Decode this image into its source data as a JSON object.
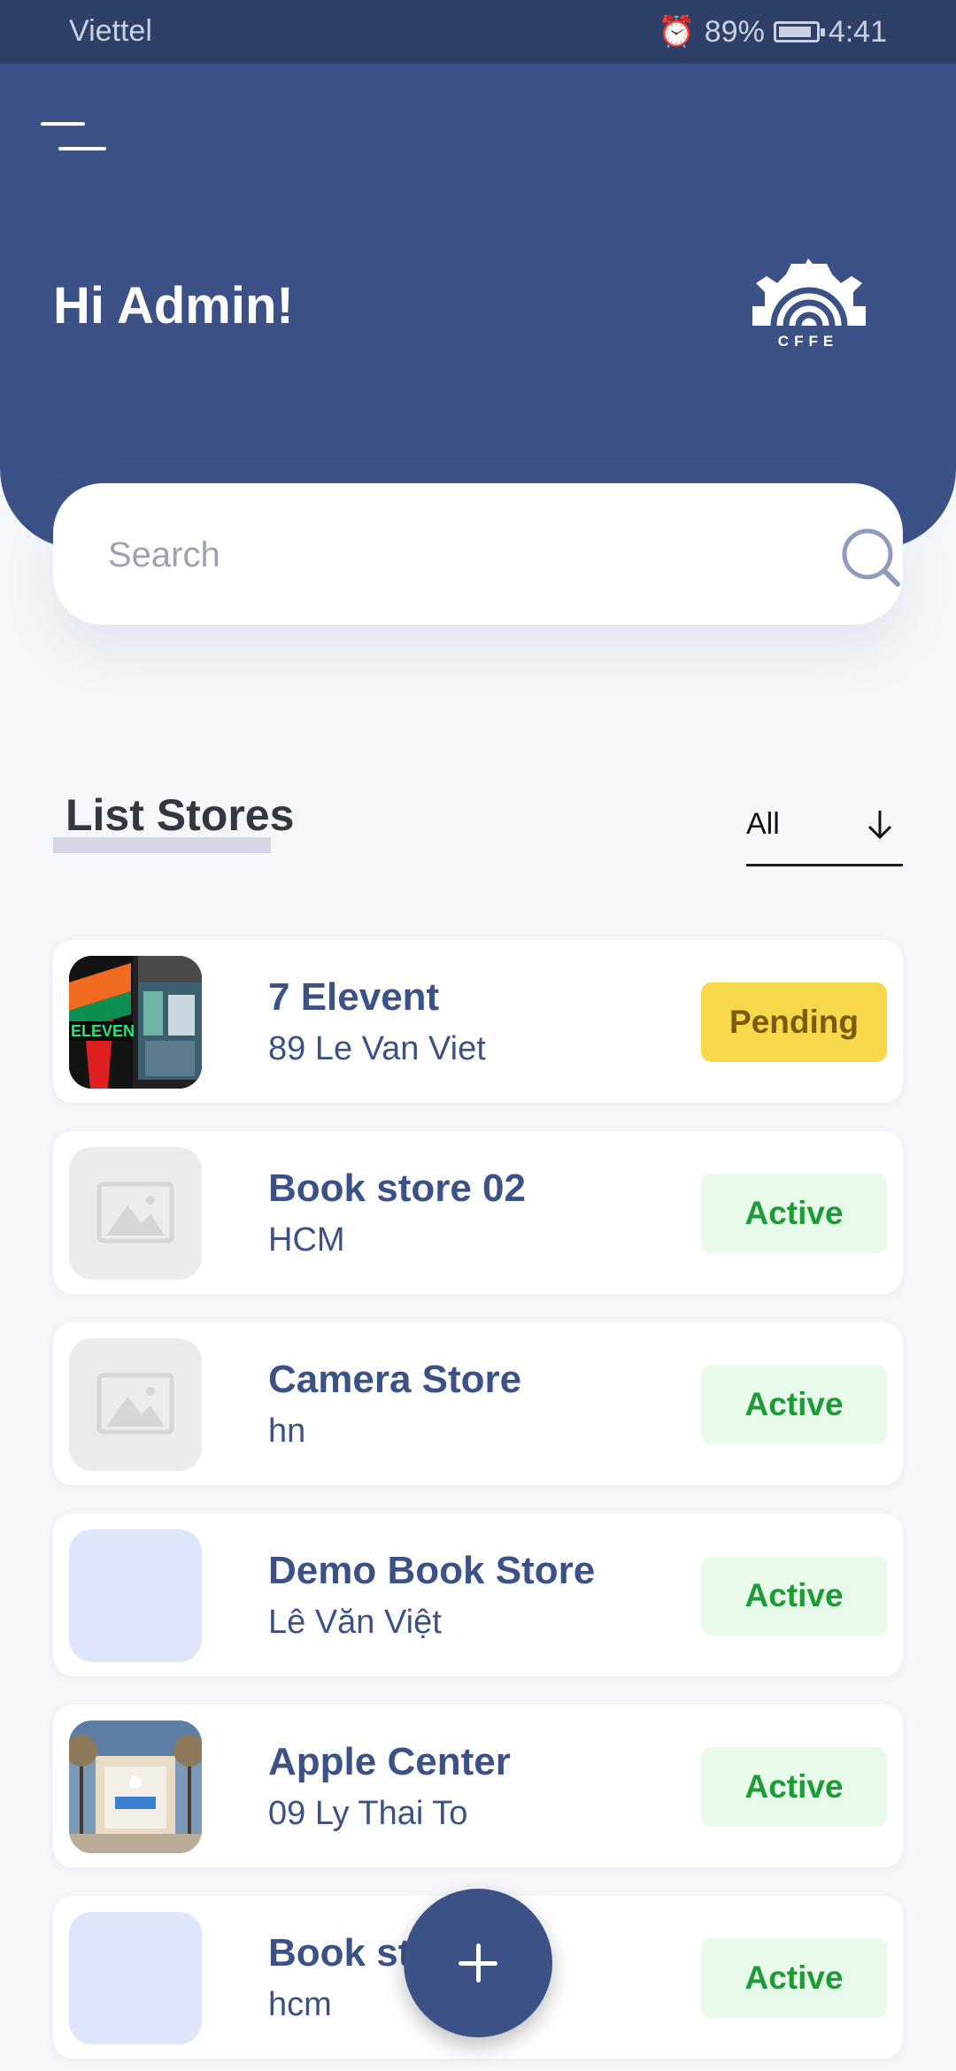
{
  "status_bar": {
    "carrier": "Viettel",
    "battery": "89%",
    "battery_level": 0.89,
    "time": "4:41"
  },
  "header": {
    "greeting": "Hi Admin!",
    "logo_text": "CFFE"
  },
  "search": {
    "placeholder": "Search",
    "value": ""
  },
  "section": {
    "title": "List Stores",
    "filter_value": "All"
  },
  "stores": [
    {
      "name": "7 Elevent",
      "address": "89 Le Van Viet",
      "status": "Pending",
      "image": "store-photo"
    },
    {
      "name": "Book store 02",
      "address": "HCM",
      "status": "Active",
      "image": "image-placeholder-icon"
    },
    {
      "name": "Camera Store",
      "address": "hn",
      "status": "Active",
      "image": "image-placeholder-icon"
    },
    {
      "name": "Demo Book Store",
      "address": "Lê Văn Việt",
      "status": "Active",
      "image": "blank"
    },
    {
      "name": "Apple Center",
      "address": "09 Ly Thai To",
      "status": "Active",
      "image": "store-photo"
    },
    {
      "name": "Book store",
      "address": "hcm",
      "status": "Active",
      "image": "blank"
    }
  ],
  "colors": {
    "primary": "#3c5287",
    "status_bar": "#2f4068",
    "active_bg": "#e8fbea",
    "active_text": "#1f9a37",
    "pending_bg": "#f7d84a",
    "pending_text": "#7a5a0f"
  }
}
